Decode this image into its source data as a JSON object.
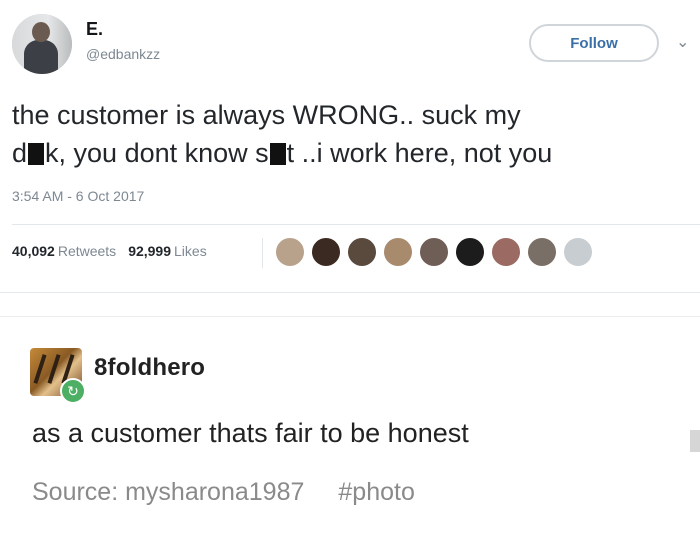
{
  "tweet": {
    "display_name": "E.",
    "handle": "@edbankzz",
    "follow_label": "Follow",
    "caret": "⌄",
    "text_lines": [
      {
        "before": "the customer is always WRONG.. suck my",
        "after": ""
      },
      {
        "before": "d",
        "mid1": "k, you dont know s",
        "mid2": "t ..i work here, not you"
      }
    ],
    "timestamp": "3:54 AM - 6 Oct 2017",
    "retweets_count": "40,092",
    "retweets_label": "Retweets",
    "likes_count": "92,999",
    "likes_label": "Likes",
    "liker_colors": [
      "#b9a28c",
      "#3b2a22",
      "#5a4a3e",
      "#a88b6d",
      "#6e5e56",
      "#1c1c1c",
      "#9b6b63",
      "#7a6f66",
      "#c8cdd2"
    ]
  },
  "post": {
    "username": "8foldhero",
    "body": "as a customer thats fair to be honest",
    "source_label": "Source: mysharona1987",
    "tag": "#photo",
    "reblog_icon": "↻"
  },
  "colors": {
    "link": "#3b6fa8",
    "muted": "#7d8892",
    "reblog": "#4caf63"
  }
}
